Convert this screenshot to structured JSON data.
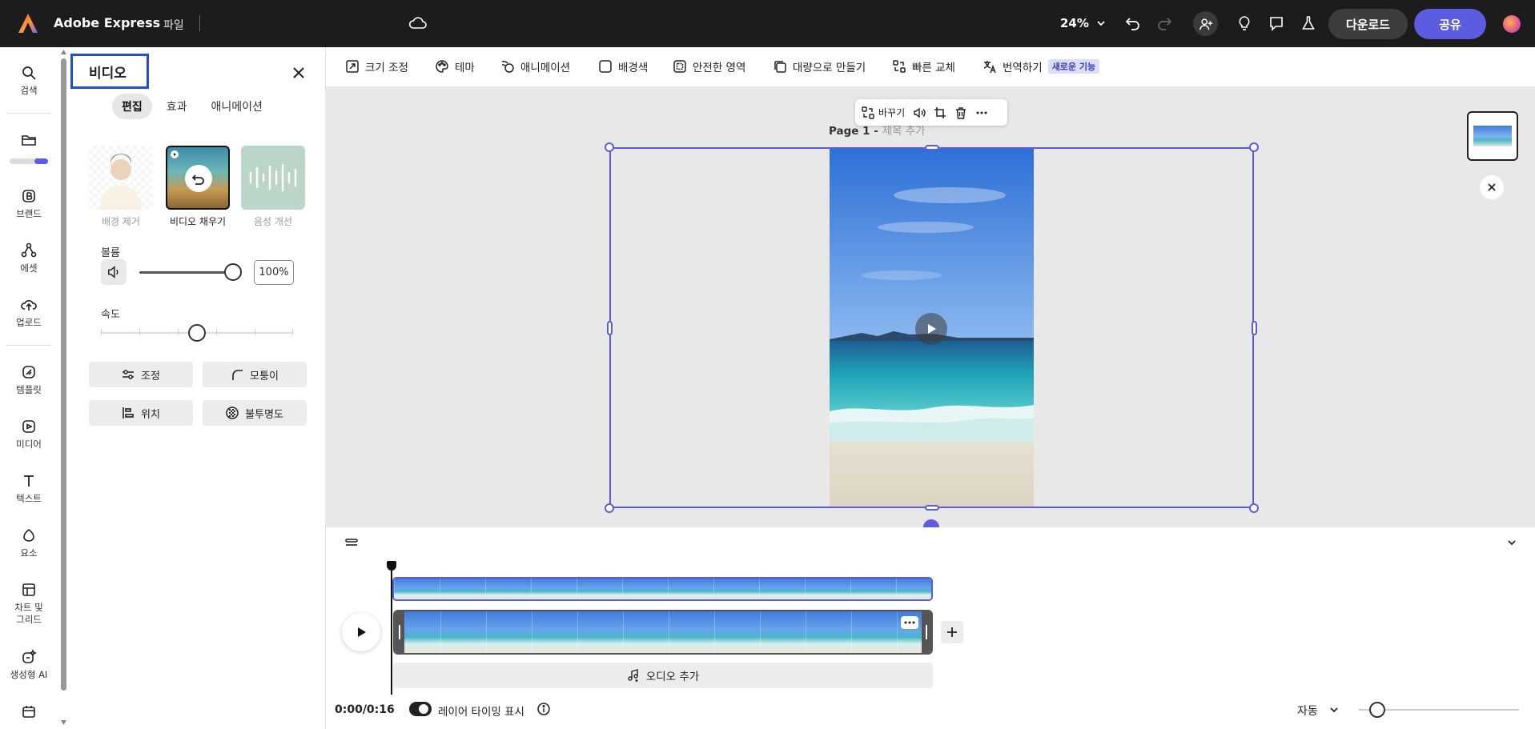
{
  "topbar": {
    "app_title": "Adobe Express",
    "file_menu": "파일",
    "zoom": "24%",
    "download_label": "다운로드",
    "share_label": "공유",
    "accent_color": "#5c5ce0"
  },
  "rail": {
    "items": [
      {
        "label": "검색",
        "icon": "search-icon"
      },
      {
        "label": "",
        "icon": "folder-icon"
      },
      {
        "label": "브랜드",
        "icon": "brand-icon"
      },
      {
        "label": "에셋",
        "icon": "assets-icon"
      },
      {
        "label": "업로드",
        "icon": "upload-icon"
      },
      {
        "label": "템플릿",
        "icon": "template-icon"
      },
      {
        "label": "미디어",
        "icon": "media-icon"
      },
      {
        "label": "텍스트",
        "icon": "text-icon"
      },
      {
        "label": "요소",
        "icon": "elements-icon"
      },
      {
        "label": "차트 및\n그리드",
        "icon": "grid-icon"
      },
      {
        "label": "생성형 AI",
        "icon": "ai-icon"
      },
      {
        "label": "",
        "icon": "calendar-icon"
      }
    ],
    "storage_used_fraction": 0.35
  },
  "panel": {
    "title": "비디오",
    "tabs": [
      "편집",
      "효과",
      "애니메이션"
    ],
    "active_tab": "편집",
    "features": [
      {
        "label": "배경 제거",
        "state": "disabled"
      },
      {
        "label": "비디오 채우기",
        "state": "selected"
      },
      {
        "label": "음성 개선",
        "state": "disabled"
      }
    ],
    "volume_label": "볼륨",
    "volume_value": "100%",
    "volume_fraction": 1.0,
    "speed_label": "속도",
    "speed_fraction": 0.5,
    "buttons": [
      "조정",
      "모퉁이",
      "위치",
      "불투명도"
    ]
  },
  "ctxbar": {
    "items": [
      "크기 조정",
      "테마",
      "애니메이션",
      "배경색",
      "안전한 영역",
      "대량으로 만들기",
      "빠른 교체",
      "번역하기"
    ],
    "new_badge": "새로운 기능"
  },
  "canvas": {
    "page_label": "Page 1 -",
    "page_sublabel": "제목 추가",
    "float_toolbar_replace": "바꾸기"
  },
  "timeline": {
    "add_audio_label": "오디오 추가",
    "time": "0:00/0:16",
    "layer_timing_label": "레이어 타이밍 표시",
    "layer_timing_on": true,
    "zoom_mode": "자동"
  }
}
